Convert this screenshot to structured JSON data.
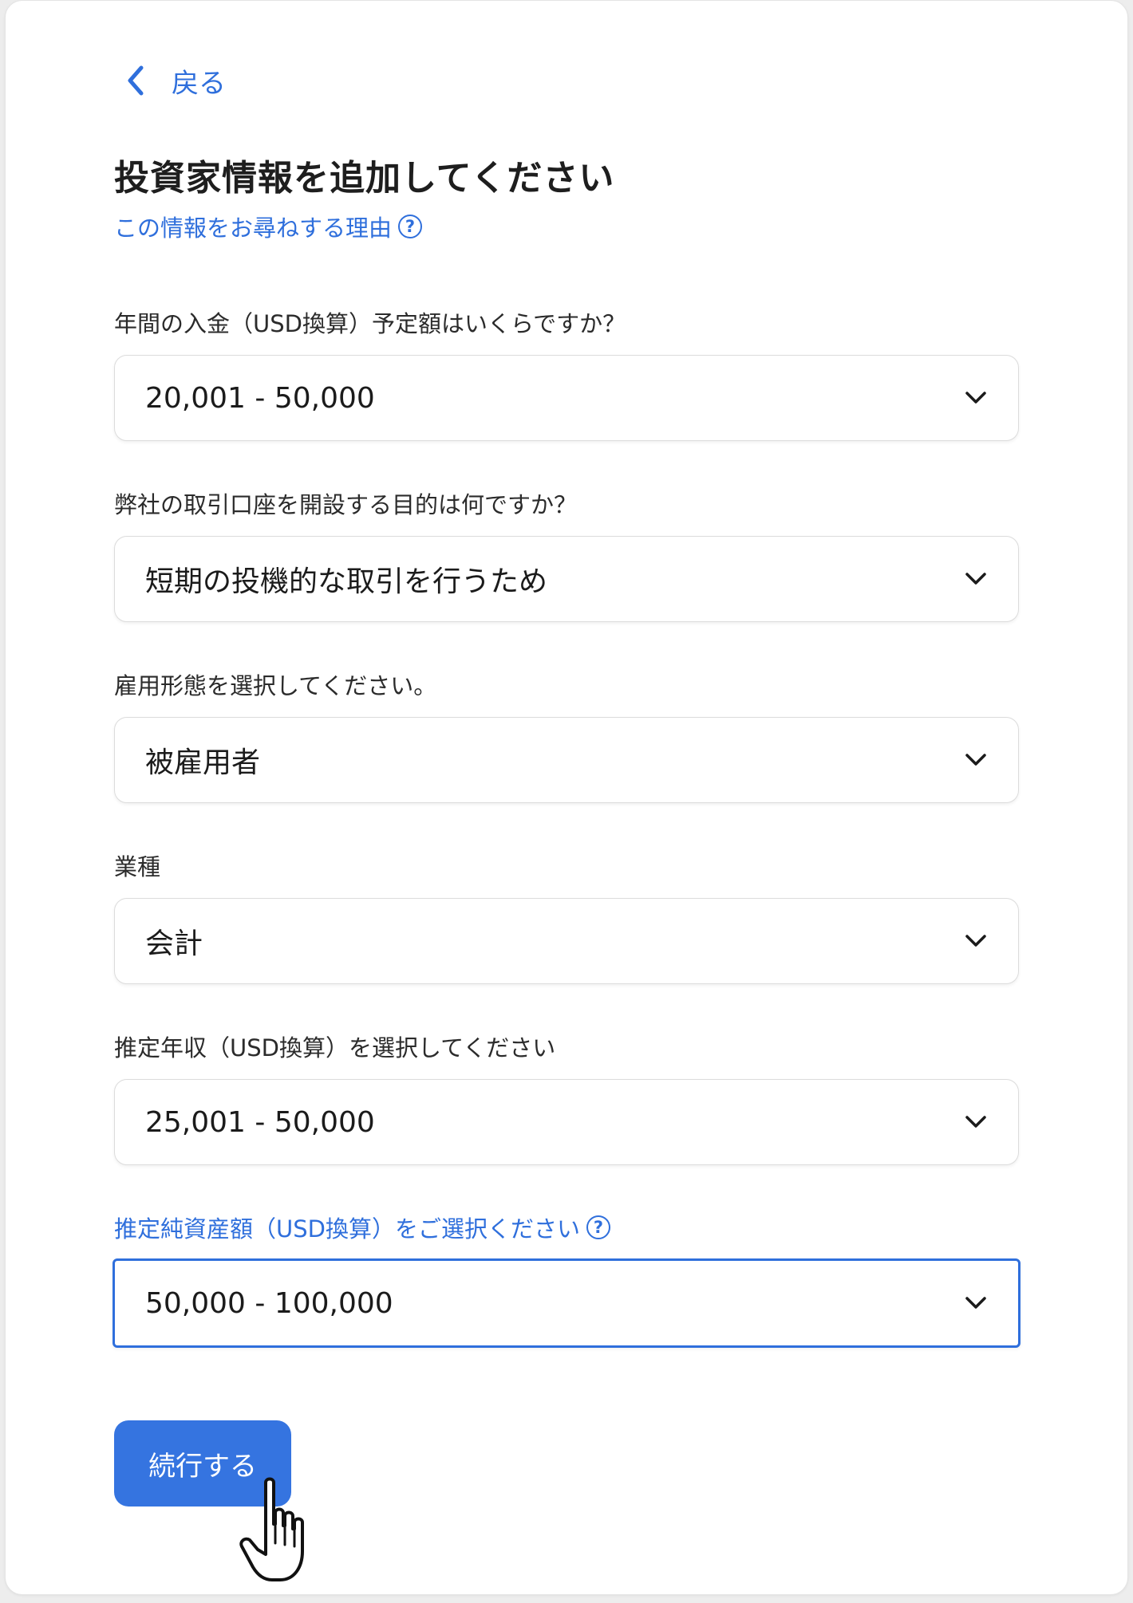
{
  "nav": {
    "back_label": "戻る"
  },
  "header": {
    "title": "投資家情報を追加してください",
    "reason_link": "この情報をお尋ねする理由"
  },
  "form": {
    "fields": [
      {
        "label": "年間の入金（USD換算）予定額はいくらですか？",
        "value": "20,001 - 50,000"
      },
      {
        "label": "弊社の取引口座を開設する目的は何ですか？",
        "value": "短期の投機的な取引を行うため"
      },
      {
        "label": "雇用形態を選択してください。",
        "value": "被雇用者"
      },
      {
        "label": "業種",
        "value": "会計"
      },
      {
        "label": "推定年収（USD換算）を選択してください",
        "value": "25,001 - 50,000"
      },
      {
        "label": "推定純資産額（USD換算）をご選択ください",
        "value": "50,000 - 100,000"
      }
    ],
    "continue_label": "続行する"
  },
  "icons": {
    "back": "chevron-left-icon",
    "help": "question-circle-icon",
    "dropdown": "chevron-down-icon",
    "cursor": "hand-pointer-icon"
  },
  "colors": {
    "accent": "#2f6fdc",
    "button": "#3574e0",
    "text": "#1f1f1f",
    "border": "#dcdcdc"
  }
}
